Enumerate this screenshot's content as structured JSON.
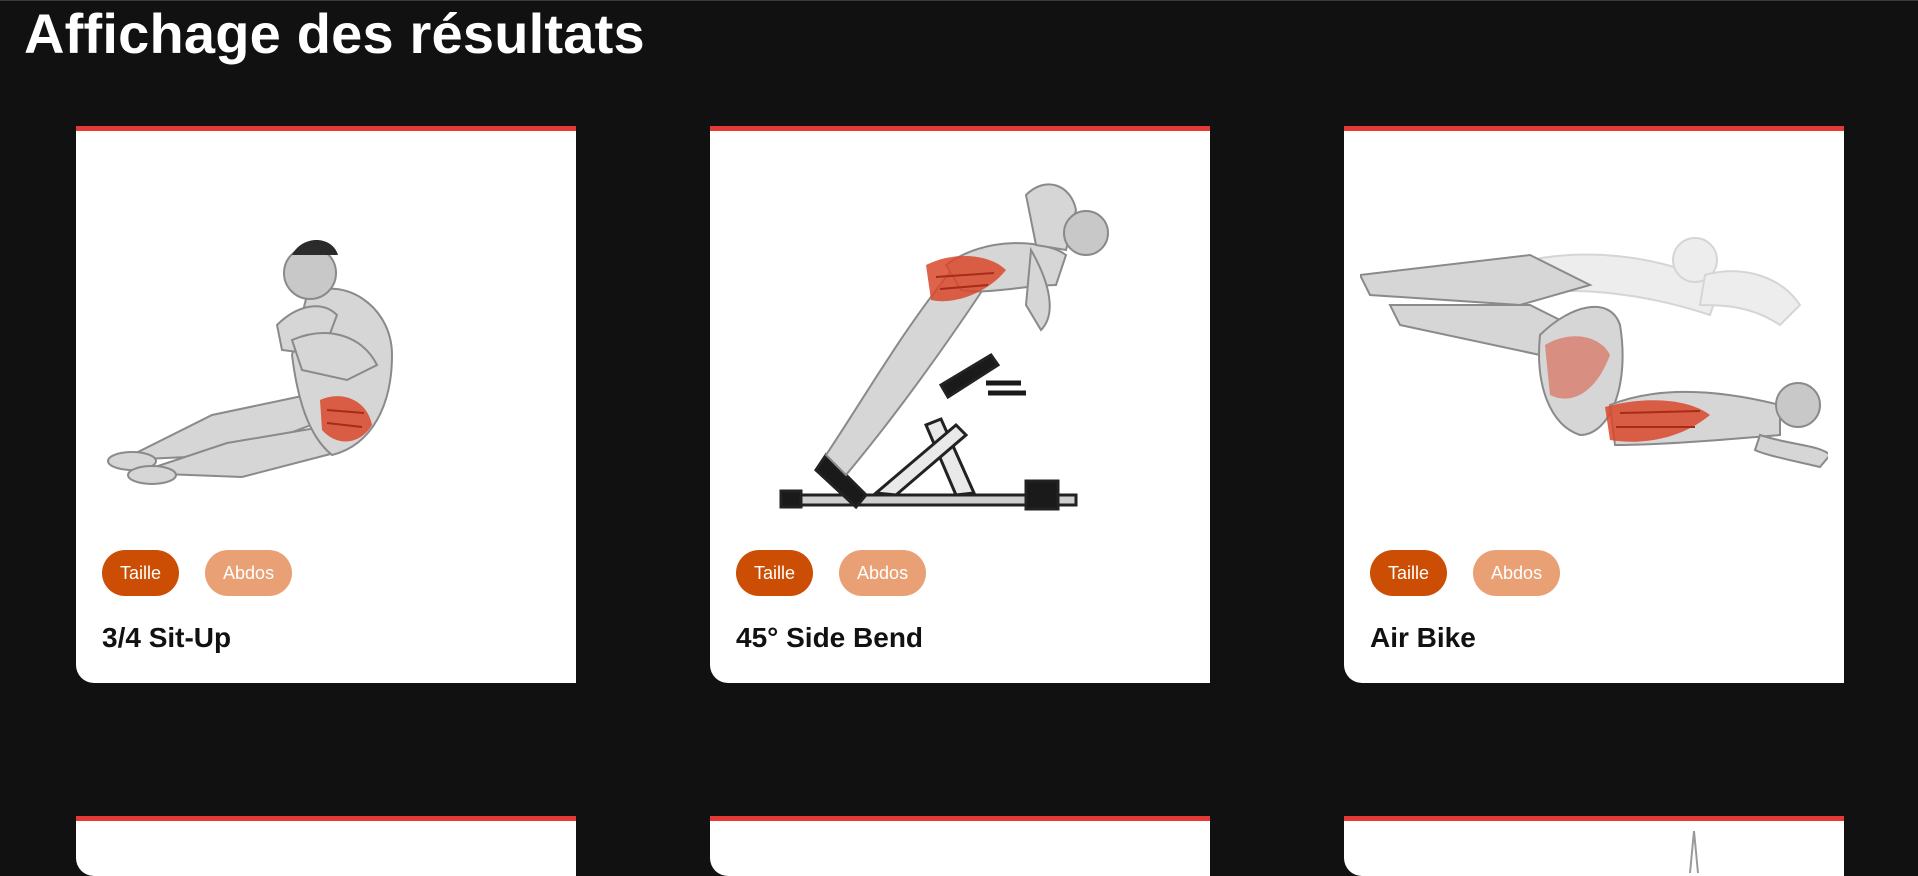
{
  "page": {
    "title": "Affichage des résultats"
  },
  "exercises": [
    {
      "name": "3/4 Sit-Up",
      "tags": [
        "Taille",
        "Abdos"
      ],
      "image_icon": "sit-up-illustration"
    },
    {
      "name": "45° Side Bend",
      "tags": [
        "Taille",
        "Abdos"
      ],
      "image_icon": "side-bend-illustration"
    },
    {
      "name": "Air Bike",
      "tags": [
        "Taille",
        "Abdos"
      ],
      "image_icon": "air-bike-illustration"
    }
  ],
  "colors": {
    "background": "#111111",
    "card_accent": "#e53935",
    "tag_primary": "#cc4e04",
    "tag_secondary": "#e8a074",
    "muscle_highlight": "#d9472b"
  }
}
